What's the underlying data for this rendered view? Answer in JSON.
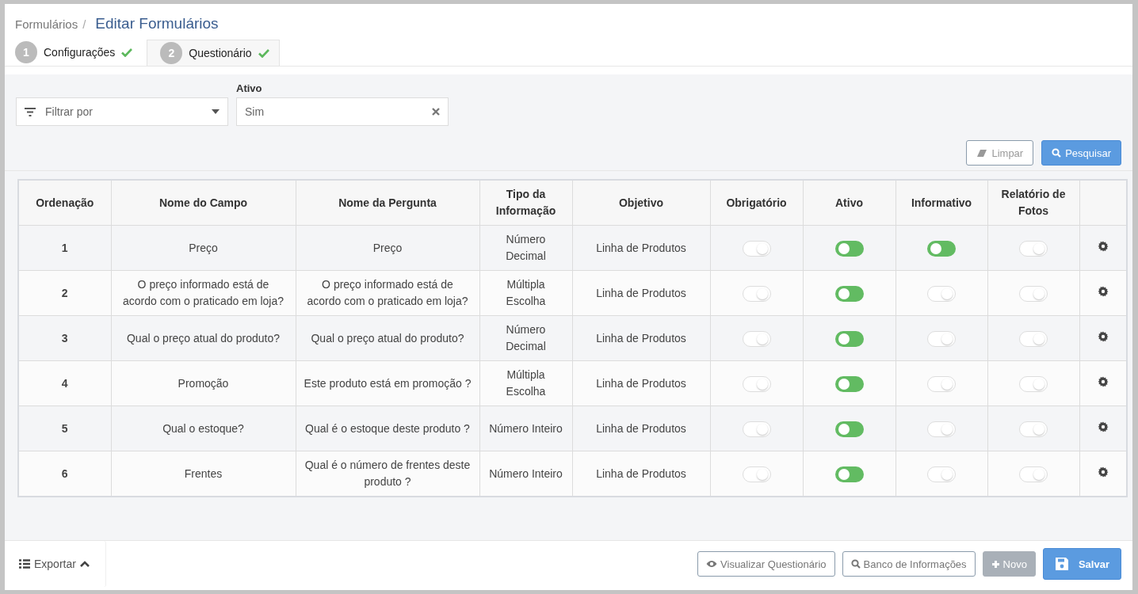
{
  "breadcrumb": {
    "parent": "Formulários",
    "separator": "/",
    "current": "Editar Formulários"
  },
  "steps": [
    {
      "number": "1",
      "label": "Configurações",
      "done": true,
      "selected": false
    },
    {
      "number": "2",
      "label": "Questionário",
      "done": true,
      "selected": true
    }
  ],
  "filters": {
    "filter_select": {
      "placeholder": "Filtrar por"
    },
    "ativo": {
      "label": "Ativo",
      "value": "Sim"
    }
  },
  "filter_buttons": [
    {
      "label": "Limpar",
      "kind": "secondary"
    },
    {
      "label": "Pesquisar",
      "kind": "primary"
    }
  ],
  "table": {
    "columns": [
      "Ordenação",
      "Nome do Campo",
      "Nome da Pergunta",
      "Tipo da Informação",
      "Objetivo",
      "Obrigatório",
      "Ativo",
      "Informativo",
      "Relatório de Fotos"
    ],
    "rows": [
      {
        "ordem": "1",
        "campo": "Preço",
        "pergunta": "Preço",
        "tipo": "Número Decimal",
        "objetivo": "Linha de Produtos",
        "obrigatorio": false,
        "ativo": true,
        "informativo": true,
        "relatorio_fotos": false
      },
      {
        "ordem": "2",
        "campo": "O preço informado está de acordo com o praticado em loja?",
        "pergunta": "O preço informado está de acordo com o praticado em loja?",
        "tipo": "Múltipla Escolha",
        "objetivo": "Linha de Produtos",
        "obrigatorio": false,
        "ativo": true,
        "informativo": false,
        "relatorio_fotos": false
      },
      {
        "ordem": "3",
        "campo": "Qual o preço atual do produto?",
        "pergunta": "Qual o preço atual do produto?",
        "tipo": "Número Decimal",
        "objetivo": "Linha de Produtos",
        "obrigatorio": false,
        "ativo": true,
        "informativo": false,
        "relatorio_fotos": false
      },
      {
        "ordem": "4",
        "campo": "Promoção",
        "pergunta": "Este produto está em promoção ?",
        "tipo": "Múltipla Escolha",
        "objetivo": "Linha de Produtos",
        "obrigatorio": false,
        "ativo": true,
        "informativo": false,
        "relatorio_fotos": false
      },
      {
        "ordem": "5",
        "campo": "Qual o estoque?",
        "pergunta": "Qual é o estoque deste produto ?",
        "tipo": "Número Inteiro",
        "objetivo": "Linha de Produtos",
        "obrigatorio": false,
        "ativo": true,
        "informativo": false,
        "relatorio_fotos": false
      },
      {
        "ordem": "6",
        "campo": "Frentes",
        "pergunta": "Qual é o número de frentes deste produto ?",
        "tipo": "Número Inteiro",
        "objetivo": "Linha de Produtos",
        "obrigatorio": false,
        "ativo": true,
        "informativo": false,
        "relatorio_fotos": false
      }
    ]
  },
  "footer": {
    "export": {
      "label": "Exportar"
    },
    "buttons": [
      {
        "label": "Visualizar Questionário",
        "kind": "outline",
        "disabled": false
      },
      {
        "label": "Banco de Informações",
        "kind": "outline",
        "disabled": false
      },
      {
        "label": "Novo",
        "kind": "outline",
        "disabled": true
      },
      {
        "label": "Salvar",
        "kind": "primary",
        "disabled": false
      }
    ]
  }
}
